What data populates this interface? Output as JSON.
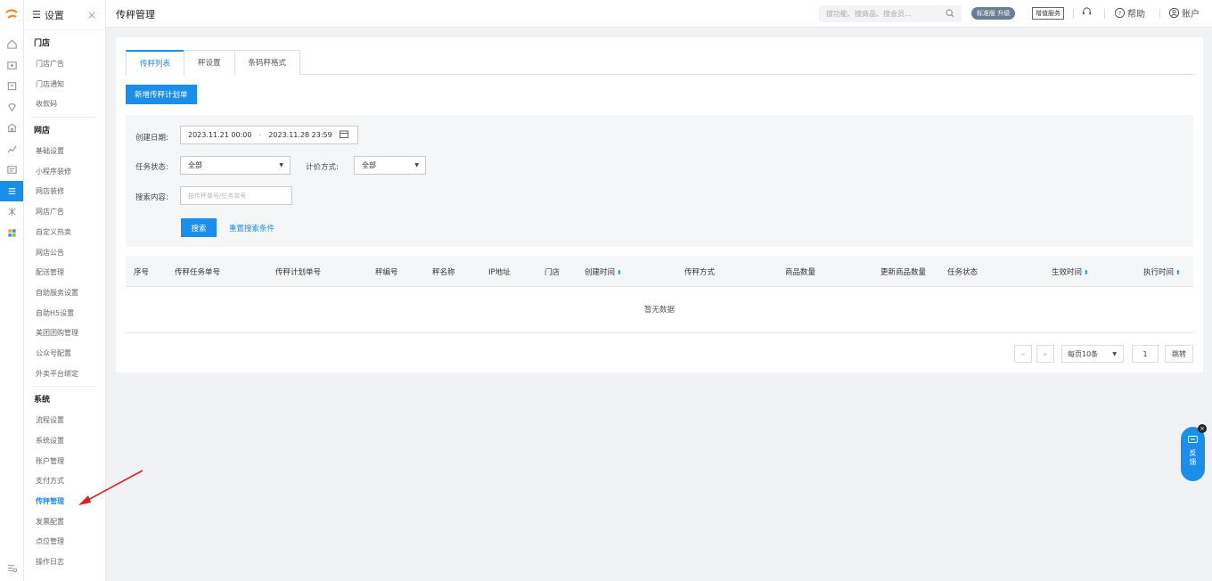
{
  "sidebar": {
    "title": "设置",
    "groups": [
      {
        "title": "门店",
        "items": [
          "门店广告",
          "门店通知",
          "收款码"
        ]
      },
      {
        "title": "网店",
        "items": [
          "基础设置",
          "小程序装修",
          "网店装修",
          "网店广告",
          "自定义热卖",
          "网店公告",
          "配送管理",
          "自助服务设置",
          "自助H5设置",
          "美团团购管理",
          "公众号配置",
          "外卖平台绑定"
        ]
      },
      {
        "title": "系统",
        "items": [
          "流程设置",
          "系统设置",
          "账户管理",
          "支付方式",
          "传秤管理",
          "发票配置",
          "点位管理",
          "操作日志"
        ]
      }
    ],
    "active_item": "传秤管理"
  },
  "topbar": {
    "title": "传秤管理",
    "search_placeholder": "搜功能、搜商品、搜会员...",
    "edition_badge": "标准版 升级",
    "value_added": "增值服务",
    "help": "帮助",
    "account": "账户"
  },
  "tabs": [
    "传秤列表",
    "秤设置",
    "条码秤格式"
  ],
  "active_tab": "传秤列表",
  "new_button": "新增传秤计划单",
  "filter": {
    "date_label": "创建日期:",
    "date_start": "2023.11.21 00:00",
    "date_sep": "-",
    "date_end": "2023.11.28 23:59",
    "status_label": "任务状态:",
    "status_value": "全部",
    "pricing_label": "计价方式:",
    "pricing_value": "全部",
    "search_label": "搜索内容:",
    "search_placeholder": "按传秤单号/任务单号",
    "search_button": "搜索",
    "reset_link": "重置搜索条件"
  },
  "table": {
    "columns": [
      "序号",
      "传秤任务单号",
      "传秤计划单号",
      "秤编号",
      "秤名称",
      "IP地址",
      "门店",
      "创建时间",
      "传秤方式",
      "商品数量",
      "更新商品数量",
      "任务状态",
      "生效时间",
      "执行时间"
    ],
    "empty_text": "暂无数据"
  },
  "pagination": {
    "prev": "«",
    "next": "»",
    "page_size": "每页10条",
    "page": "1",
    "jump": "跳转"
  },
  "feedback": {
    "label": "反馈",
    "close": "×"
  },
  "colors": {
    "accent": "#1a8ee8",
    "badge": "#6b7c93"
  }
}
